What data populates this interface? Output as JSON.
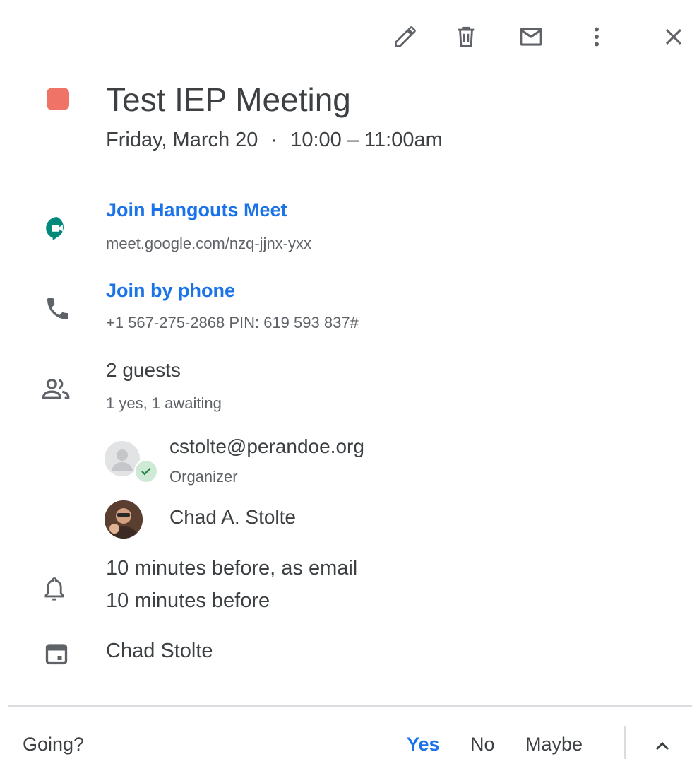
{
  "toolbar": {
    "edit_icon": "pencil-icon",
    "delete_icon": "trash-icon",
    "email_icon": "envelope-icon",
    "more_icon": "more-vert-icon",
    "close_icon": "close-icon"
  },
  "event": {
    "color": "#f07368",
    "title": "Test IEP Meeting",
    "date": "Friday, March 20",
    "separator": "·",
    "time": "10:00 – 11:00am"
  },
  "meet": {
    "label": "Join Hangouts Meet",
    "url": "meet.google.com/nzq-jjnx-yxx",
    "icon_color": "#00897b"
  },
  "phone": {
    "label": "Join by phone",
    "details": "+1 567-275-2868 PIN: 619 593 837#"
  },
  "guests": {
    "count_label": "2 guests",
    "summary": "1 yes, 1 awaiting",
    "list": [
      {
        "name": "cstolte@perandoe.org",
        "role": "Organizer"
      },
      {
        "name": "Chad A. Stolte",
        "role": ""
      }
    ]
  },
  "notifications": {
    "items": [
      "10 minutes before, as email",
      "10 minutes before"
    ]
  },
  "calendar": {
    "owner": "Chad Stolte"
  },
  "rsvp": {
    "question": "Going?",
    "yes": "Yes",
    "no": "No",
    "maybe": "Maybe",
    "accent": "#1a73e8"
  }
}
